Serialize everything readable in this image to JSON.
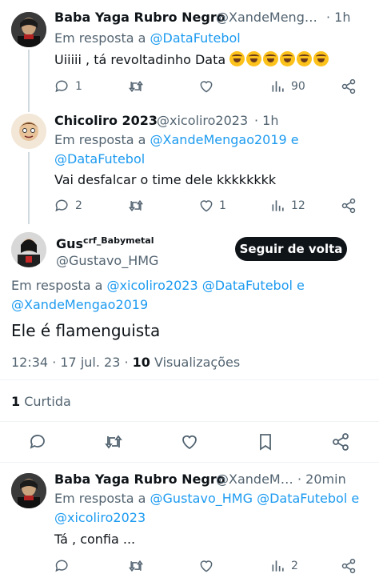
{
  "reply1": {
    "name": "Baba Yaga Rubro Negro",
    "handle": "@XandeMeng…",
    "time": "· 1h",
    "reply_prefix": "Em resposta a",
    "reply_to": "@DataFutebol",
    "text": "Uiiiii , tá revoltadinho Data",
    "emoji_count": 6,
    "replies": "1",
    "retweets": "",
    "likes": "",
    "views": "90"
  },
  "reply2": {
    "name": "Chicoliro 2023",
    "handle": "@xicoliro2023",
    "time": "· 1h",
    "reply_prefix": "Em resposta a",
    "reply_to_1": "@XandeMengao2019",
    "reply_and": "e",
    "reply_to_2": "@DataFutebol",
    "text": "Vai desfalcar o time dele kkkkkkkk",
    "replies": "2",
    "retweets": "",
    "likes": "1",
    "views": "12"
  },
  "main": {
    "name": "Gus",
    "name_suffix": "crf_Babymetal",
    "handle": "@Gustavo_HMG",
    "follow_label": "Seguir de volta",
    "reply_prefix": "Em resposta a",
    "reply_to_1": "@xicoliro2023",
    "reply_to_2": "@DataFutebol",
    "reply_and": "e",
    "reply_to_3": "@XandeMengao2019",
    "text": "Ele é flamenguista",
    "timestamp": "12:34 · 17 jul. 23 ·",
    "views_count": "10",
    "views_label": "Visualizações",
    "likes_count": "1",
    "likes_label": "Curtida"
  },
  "reply3": {
    "name": "Baba Yaga Rubro Negro",
    "handle": "@XandeM…",
    "time": "· 20min",
    "reply_prefix": "Em resposta a",
    "reply_to_1": "@Gustavo_HMG",
    "reply_to_2": "@DataFutebol",
    "reply_and": "e",
    "reply_to_3": "@xicoliro2023",
    "text": "Tá , confia ...",
    "replies": "",
    "retweets": "",
    "likes": "",
    "views": "2"
  },
  "colors": {
    "link": "#1d9bf0",
    "muted": "#536471",
    "text": "#0f1419",
    "divider": "#eff3f4"
  }
}
